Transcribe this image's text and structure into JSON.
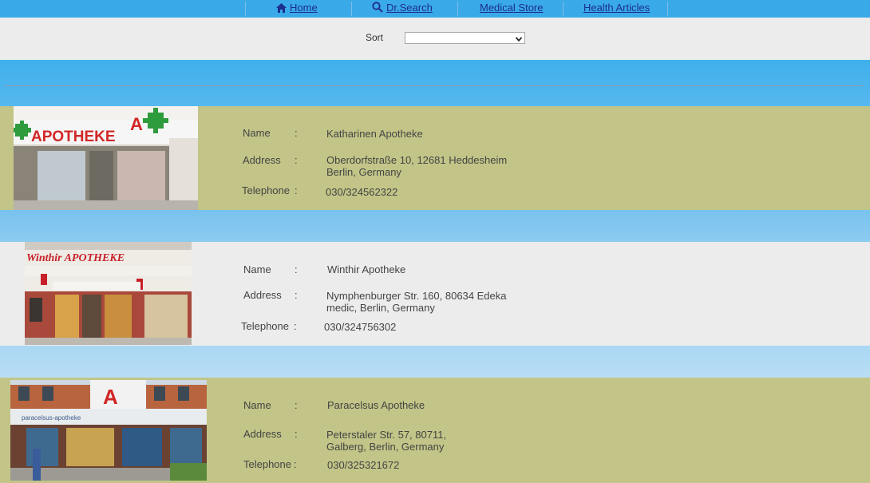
{
  "nav": {
    "items": [
      {
        "label": "Home",
        "icon": "home-icon"
      },
      {
        "label": "Dr.Search",
        "icon": "search-icon"
      },
      {
        "label": "Medical Store",
        "icon": null
      },
      {
        "label": "Health Articles",
        "icon": null
      }
    ],
    "link_color": "#1b2d8f",
    "bar_color": "#3aa9e8"
  },
  "sort": {
    "label": "Sort",
    "selected": ""
  },
  "labels": {
    "name": "Name",
    "address": "Address",
    "telephone": "Telephone",
    "colon": ":"
  },
  "listings": [
    {
      "name": "Katharinen Apotheke",
      "address_line1": "Oberdorfstraße 10, 12681 Heddesheim",
      "address_line2": "Berlin, Germany",
      "telephone": "030/324562322",
      "photo_sign": "APOTHEKE",
      "row_color": "#c2c587"
    },
    {
      "name": "Winthir Apotheke",
      "address_line1": "Nymphenburger Str. 160, 80634 Edeka",
      "address_line2": "medic, Berlin, Germany",
      "telephone": "030/324756302",
      "photo_sign": "Winthir APOTHEKE",
      "row_color": "#ececec"
    },
    {
      "name": "Paracelsus Apotheke",
      "address_line1": "Peterstaler Str. 57, 80711,",
      "address_line2": "Galberg, Berlin, Germany",
      "telephone": "030/325321672",
      "photo_sign": "paracelsus-apotheke",
      "row_color": "#c2c587"
    }
  ]
}
